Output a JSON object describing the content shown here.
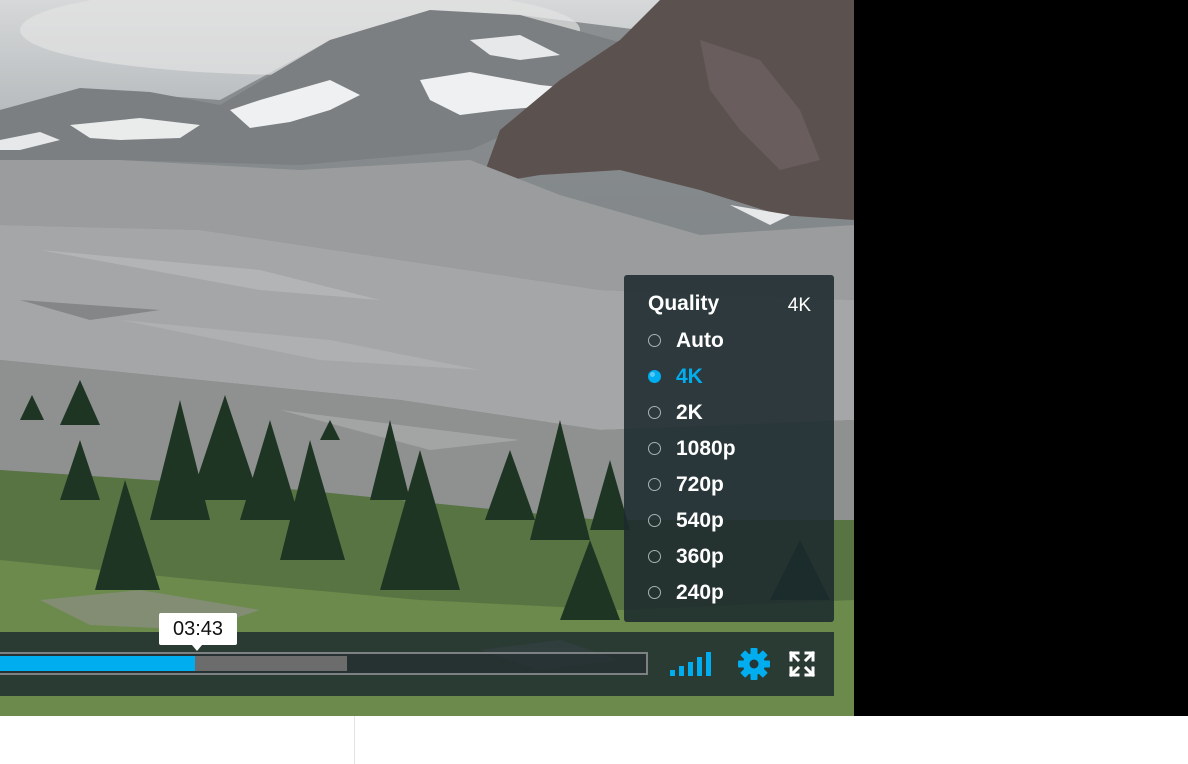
{
  "player": {
    "quality_menu": {
      "title": "Quality",
      "current": "4K",
      "options": [
        {
          "label": "Auto",
          "selected": false
        },
        {
          "label": "4K",
          "selected": true
        },
        {
          "label": "2K",
          "selected": false
        },
        {
          "label": "1080p",
          "selected": false
        },
        {
          "label": "720p",
          "selected": false
        },
        {
          "label": "540p",
          "selected": false
        },
        {
          "label": "360p",
          "selected": false
        },
        {
          "label": "240p",
          "selected": false
        }
      ]
    },
    "progress": {
      "played_fraction": 0.302,
      "loaded_fraction": 0.537,
      "hover_time": "03:43"
    },
    "icons": {
      "signal": "signal-strength-icon",
      "settings": "gear-icon",
      "fullscreen": "fullscreen-icon"
    },
    "colors": {
      "accent": "#00adef",
      "panel": "#1c2a2e",
      "loaded": "#6c6c6c"
    }
  }
}
